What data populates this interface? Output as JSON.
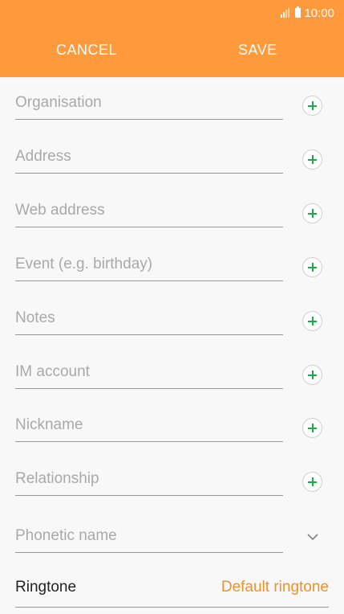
{
  "status_bar": {
    "time": "10:00",
    "signal_icon": "signal-icon",
    "battery_icon": "battery-icon"
  },
  "header": {
    "cancel_label": "CANCEL",
    "save_label": "SAVE",
    "color": "#ff9a3c"
  },
  "fields": [
    {
      "placeholder": "Organisation"
    },
    {
      "placeholder": "Address"
    },
    {
      "placeholder": "Web address"
    },
    {
      "placeholder": "Event (e.g. birthday)"
    },
    {
      "placeholder": "Notes"
    },
    {
      "placeholder": "IM account"
    },
    {
      "placeholder": "Nickname"
    },
    {
      "placeholder": "Relationship"
    },
    {
      "placeholder": "Phonetic name"
    }
  ],
  "ringtone": {
    "label": "Ringtone",
    "value": "Default ringtone",
    "value_color": "#f0912a"
  },
  "accent_add": "#1faa4a"
}
